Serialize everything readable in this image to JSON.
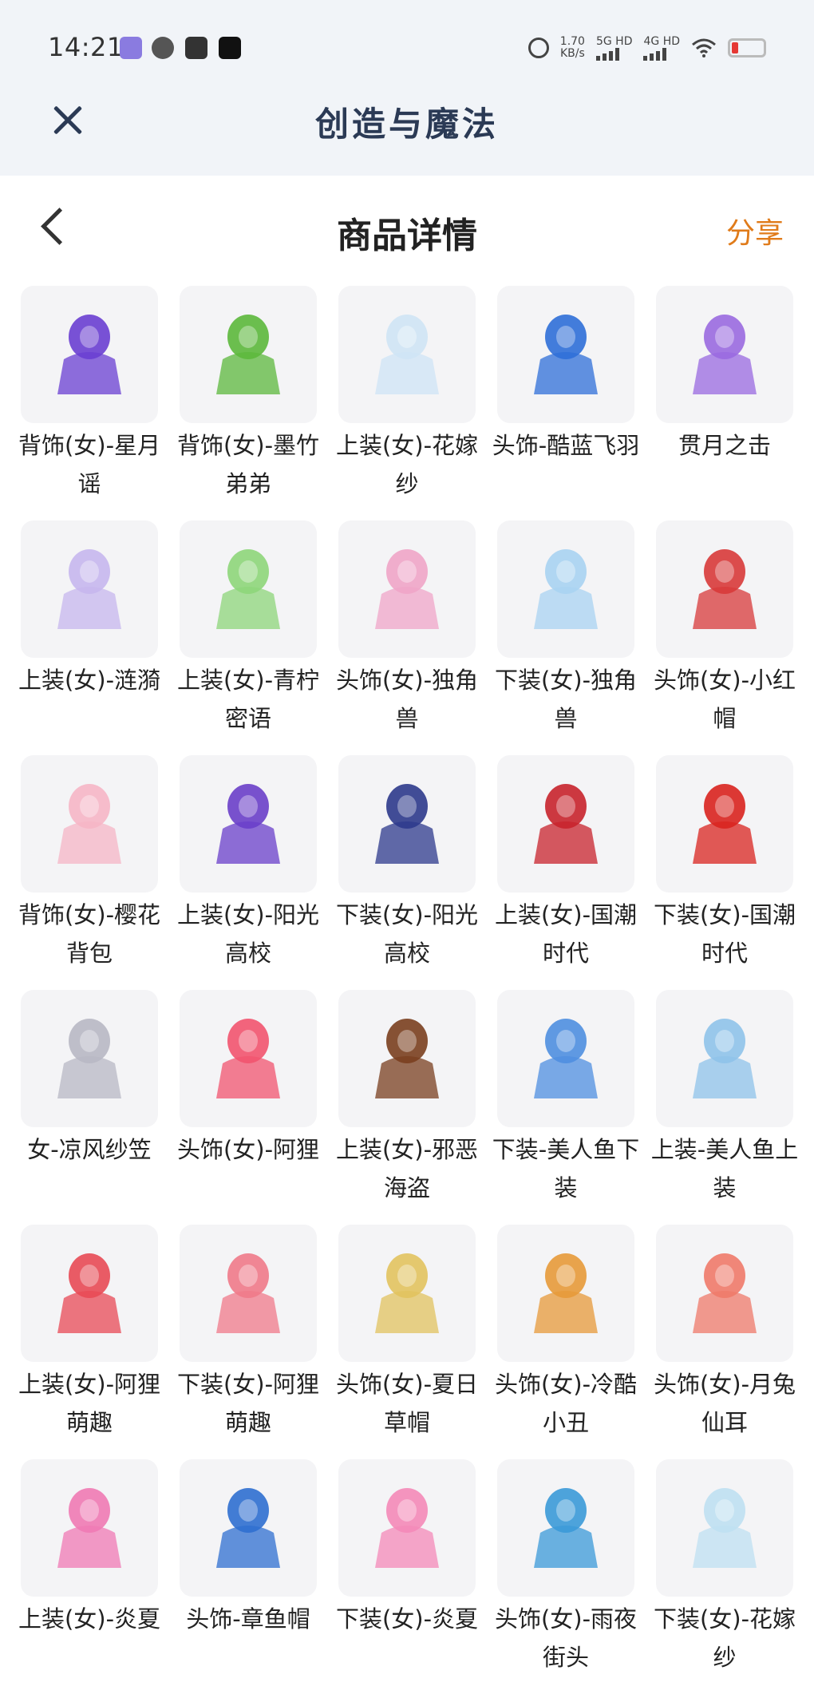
{
  "status_bar": {
    "time": "14:21",
    "net_speed_value": "1.70",
    "net_speed_unit": "KB/s",
    "sim1": "5G HD",
    "sim2": "4G HD"
  },
  "app_bar": {
    "title": "创造与魔法"
  },
  "header": {
    "title": "商品详情",
    "share_label": "分享"
  },
  "items": [
    {
      "label": "背饰(女)-星月谣",
      "color": "#6a3fd1"
    },
    {
      "label": "背饰(女)-墨竹弟弟",
      "color": "#5cb83c"
    },
    {
      "label": "上装(女)-花嫁纱",
      "color": "#cfe4f5"
    },
    {
      "label": "头饰-酷蓝飞羽",
      "color": "#2f6fd8"
    },
    {
      "label": "贯月之击",
      "color": "#9a6ae0"
    },
    {
      "label": "上装(女)-涟漪",
      "color": "#c7b7ee"
    },
    {
      "label": "上装(女)-青柠密语",
      "color": "#8ed67a"
    },
    {
      "label": "头饰(女)-独角兽",
      "color": "#f0a5c8"
    },
    {
      "label": "下装(女)-独角兽",
      "color": "#a9d3f2"
    },
    {
      "label": "头饰(女)-小红帽",
      "color": "#d83a3a"
    },
    {
      "label": "背饰(女)-樱花背包",
      "color": "#f6b6c6"
    },
    {
      "label": "上装(女)-阳光高校",
      "color": "#6a3fc9"
    },
    {
      "label": "下装(女)-阳光高校",
      "color": "#2d3a8c"
    },
    {
      "label": "上装(女)-国潮时代",
      "color": "#c8232c"
    },
    {
      "label": "下装(女)-国潮时代",
      "color": "#d9241f"
    },
    {
      "label": "女-凉风纱笠",
      "color": "#b8b8c4"
    },
    {
      "label": "头饰(女)-阿狸",
      "color": "#f2546f"
    },
    {
      "label": "上装(女)-邪恶海盗",
      "color": "#7a3f1f"
    },
    {
      "label": "下装-美人鱼下装",
      "color": "#4f8fe0"
    },
    {
      "label": "上装-美人鱼上装",
      "color": "#8fc3ea"
    },
    {
      "label": "上装(女)-阿狸萌趣",
      "color": "#e84a55"
    },
    {
      "label": "下装(女)-阿狸萌趣",
      "color": "#f07a8a"
    },
    {
      "label": "头饰(女)-夏日草帽",
      "color": "#e2c35f"
    },
    {
      "label": "头饰(女)-冷酷小丑",
      "color": "#e79a3a"
    },
    {
      "label": "头饰(女)-月兔仙耳",
      "color": "#ef7a6a"
    },
    {
      "label": "上装(女)-炎夏",
      "color": "#f07ab4"
    },
    {
      "label": "头饰-章鱼帽",
      "color": "#2f6fd0"
    },
    {
      "label": "下装(女)-炎夏",
      "color": "#f48ab8"
    },
    {
      "label": "头饰(女)-雨夜街头",
      "color": "#3b9ad8"
    },
    {
      "label": "下装(女)-花嫁纱",
      "color": "#bfe0f2"
    }
  ]
}
